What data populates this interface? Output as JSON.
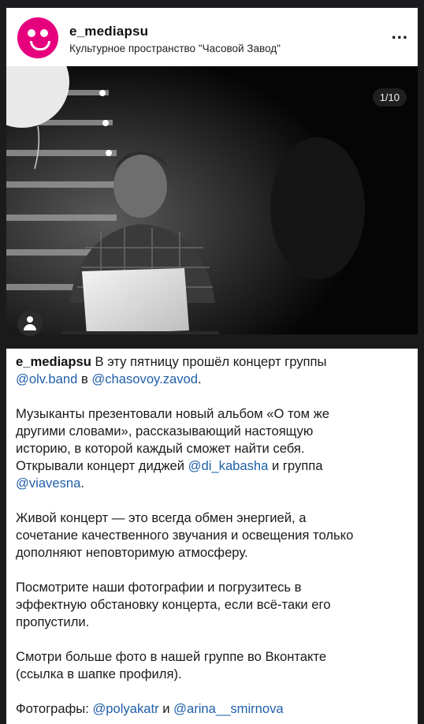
{
  "post": {
    "username": "e_mediapsu",
    "location": "Культурное пространство \"Часовой Завод\"",
    "more_label": "...",
    "counter": "1/10"
  },
  "caption": {
    "username": "e_mediapsu",
    "p1_text1": " В эту пятницу прошёл концерт группы",
    "p1_m1": "@olv.band",
    "p1_text2": " в ",
    "p1_m2": "@chasovoy.zavod",
    "p1_text3": ".",
    "p2_line1": "Музыканты презентовали новый альбом «О том же",
    "p2_line2": "другими словами», рассказывающий настоящую",
    "p2_line3": "историю, в которой каждый сможет найти себя.",
    "p2_line4": "Открывали концерт диджей ",
    "p2_m1": "@di_kabasha",
    "p2_text5": " и группа",
    "p2_m2": "@viavesna",
    "p2_text6": ".",
    "p3_line1": "Живой концерт — это всегда обмен энергией, а",
    "p3_line2": "сочетание качественного звучания и освещения только",
    "p3_line3": "дополняют неповторимую атмосферу.",
    "p4_line1": "Посмотрите наши фотографии и погрузитесь в",
    "p4_line2": "эффектную обстановку концерта, если всё-таки его",
    "p4_line3": "пропустили.",
    "p5_line1": "Смотри больше фото в нашей группе во Вконтакте",
    "p5_line2": "(ссылка в шапке профиля).",
    "p6_text": "Фотографы: ",
    "p6_m1": "@polyakatr",
    "p6_text2": " и ",
    "p6_m2": "@arina__smirnova"
  }
}
